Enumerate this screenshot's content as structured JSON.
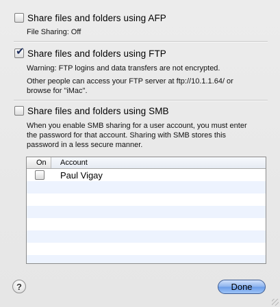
{
  "afp": {
    "label": "Share files and folders using AFP",
    "checked": false,
    "status": "File Sharing: Off"
  },
  "ftp": {
    "label": "Share files and folders using FTP",
    "checked": true,
    "warning": "Warning: FTP logins and data transfers are not encrypted.",
    "info_line1": "Other people can access your FTP server at ftp://10.1.1.64/ or",
    "info_line2": "browse for \"iMac\"."
  },
  "smb": {
    "label": "Share files and folders using SMB",
    "checked": false,
    "desc_line1": "When you enable SMB sharing for a user account, you must enter",
    "desc_line2": "the password for that account. Sharing with SMB stores this",
    "desc_line3": "password in a less secure manner."
  },
  "accounts_table": {
    "col_on": "On",
    "col_account": "Account",
    "rows": [
      {
        "on": false,
        "account": "Paul Vigay"
      }
    ]
  },
  "footer": {
    "help_label": "?",
    "done_label": "Done"
  },
  "icons": {
    "checkmark": "checkmark-icon",
    "help": "question-mark-icon"
  },
  "colors": {
    "done_button": "#7aa7ec",
    "row_stripe": "#edf3fe",
    "checkmark": "#1e2e5c"
  }
}
